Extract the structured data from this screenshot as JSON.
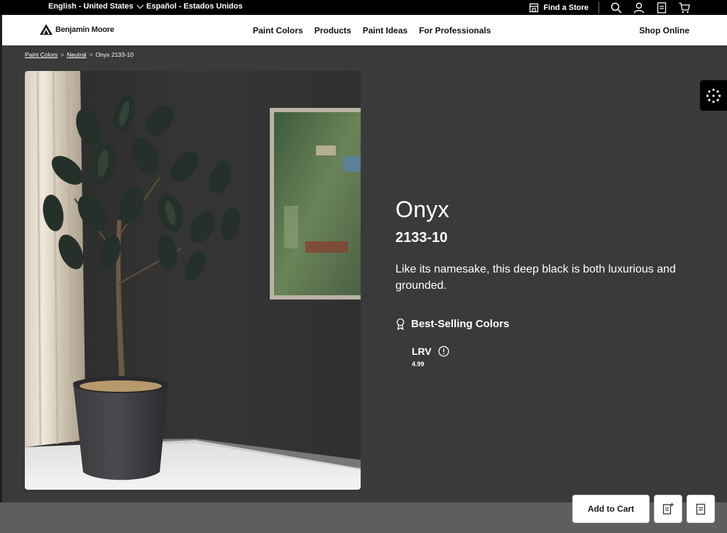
{
  "topbar": {
    "lang_primary": "English - United States",
    "lang_secondary": "Español - Estados Unidos",
    "find_store": "Find a Store",
    "icons": [
      "store-icon",
      "search-icon",
      "account-icon",
      "list-icon",
      "cart-icon"
    ]
  },
  "nav": {
    "brand": "Benjamin Moore",
    "links": [
      "Paint Colors",
      "Products",
      "Paint Ideas",
      "For Professionals"
    ],
    "shop_online": "Shop Online"
  },
  "breadcrumb": {
    "items": [
      "Paint Colors",
      "Neutral",
      "Onyx 2133-10"
    ],
    "separator": ">"
  },
  "color": {
    "name": "Onyx",
    "code": "2133-10",
    "description": "Like its namesake, this deep black is both luxurious and grounded.",
    "collection": "Best-Selling Colors",
    "lrv_label": "LRV",
    "lrv_value": "4.99"
  },
  "actions": {
    "add_to_cart": "Add to Cart"
  },
  "theme": {
    "page_bg": "#3a3a3a",
    "topbar_bg": "#000000",
    "nav_bg": "#ffffff"
  }
}
